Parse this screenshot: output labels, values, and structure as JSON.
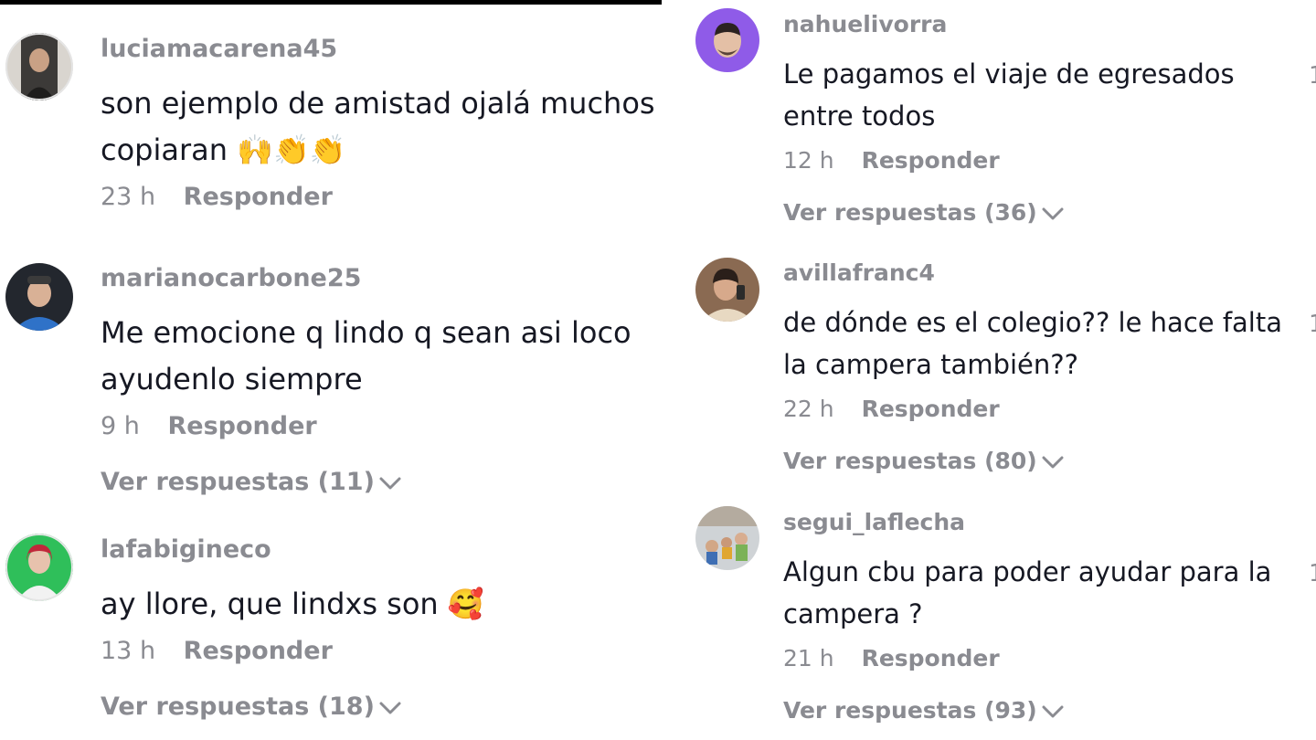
{
  "left_comments": [
    {
      "username": "luciamacarena45",
      "text": "son ejemplo de amistad ojalá muchos copiaran 🙌👏👏",
      "time": "23 h",
      "reply_label": "Responder"
    },
    {
      "username": "marianocarbone25",
      "text": "Me emocione q lindo q sean asi loco ayudenlo siempre",
      "time": "9 h",
      "reply_label": "Responder",
      "view_replies": "Ver respuestas (11)"
    },
    {
      "username": "lafabigineco",
      "text": "ay llore, que lindxs son 🥰",
      "time": "13 h",
      "reply_label": "Responder",
      "view_replies": "Ver respuestas (18)"
    }
  ],
  "right_comments": [
    {
      "username": "nahuelivorra",
      "text": "Le pagamos el viaje de egresados entre todos",
      "time": "12 h",
      "reply_label": "Responder",
      "view_replies": "Ver respuestas (36)",
      "like_count_cut": "1"
    },
    {
      "username": "avillafranc4",
      "text": "de dónde es el colegio?? le hace falta la campera también??",
      "time": "22 h",
      "reply_label": "Responder",
      "view_replies": "Ver respuestas (80)",
      "like_count_cut": "1"
    },
    {
      "username": "segui_laflecha",
      "text": "Algun cbu para poder ayudar para la campera ?",
      "time": "21 h",
      "reply_label": "Responder",
      "view_replies": "Ver respuestas (93)",
      "like_count_cut": "1"
    }
  ],
  "colors": {
    "text_primary": "#161823",
    "text_secondary": "#8a8b91",
    "avatar_purple": "#8f5be8",
    "avatar_green": "#2fbf5a"
  },
  "icons": {
    "view_replies": "chevron-down-icon"
  }
}
